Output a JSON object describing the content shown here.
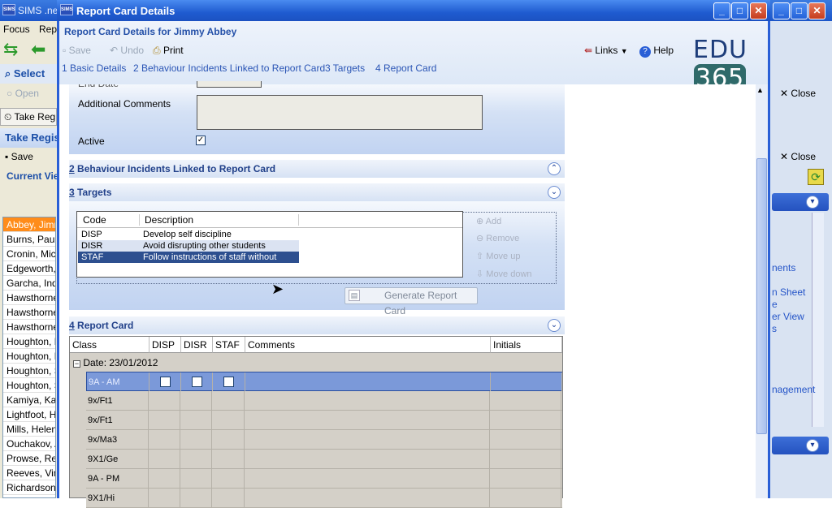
{
  "background_app": {
    "title": "SIMS .net",
    "menu": [
      "Focus",
      "Rep"
    ],
    "select_label": "Select",
    "open_label": "Open",
    "take_register_btn": "Take Reg",
    "take_register_head": "Take Regis",
    "save_label": "Save",
    "current_view_label": "Current Vie",
    "pupils": [
      "Abbey, Jimm",
      "Burns, Paul",
      "Cronin, Mich",
      "Edgeworth, I",
      "Garcha, Inde",
      "Hawsthorne",
      "Hawsthorne",
      "Hawsthorne",
      "Houghton, H",
      "Houghton, R",
      "Houghton, S",
      "Houghton, S",
      "Kamiya, Kad",
      "Lightfoot, Ha",
      "Mills, Helen",
      "Ouchakov, A",
      "Prowse, Reg",
      "Reeves, Vin",
      "Richardson,"
    ],
    "right_close_1": "Close",
    "right_close_2": "Close",
    "right_links": [
      "nents",
      "n Sheet",
      "e",
      "er View",
      "s",
      "nagement"
    ]
  },
  "dialog": {
    "title": "Report Card Details",
    "header_title": "Report Card Details for Jimmy Abbey",
    "toolbar": {
      "save": "Save",
      "undo": "Undo",
      "print": "Print",
      "links": "Links",
      "help": "Help"
    },
    "steps": [
      "1 Basic Details",
      "2 Behaviour Incidents Linked to Report Card",
      "3 Targets",
      "4 Report Card"
    ],
    "logo_prefix": "EDU",
    "logo_number": "365",
    "basic": {
      "end_date_label": "End Date",
      "additional_comments_label": "Additional Comments",
      "active_label": "Active",
      "active_checked": true
    },
    "sections": {
      "behaviour": {
        "num": "2",
        "title": "Behaviour Incidents Linked to Report Card"
      },
      "targets": {
        "num": "3",
        "title": "Targets"
      },
      "report_card": {
        "num": "4",
        "title": "Report Card"
      }
    },
    "targets": {
      "columns": [
        "Code",
        "Description"
      ],
      "rows": [
        {
          "code": "DISP",
          "desc": "Develop self discipline"
        },
        {
          "code": "DISR",
          "desc": "Avoid disrupting other students"
        },
        {
          "code": "STAF",
          "desc": "Follow instructions of staff without que..."
        }
      ],
      "side_buttons": [
        "Add",
        "Remove",
        "Move up",
        "Move down"
      ],
      "generate_button": "Generate Report Card"
    },
    "report_card": {
      "columns": [
        "Class",
        "DISP",
        "DISR",
        "STAF",
        "Comments",
        "Initials"
      ],
      "date_group": "Date: 23/01/2012",
      "rows": [
        "9A - AM",
        "9x/Ft1",
        "9x/Ft1",
        "9x/Ma3",
        "9X1/Ge",
        "9A - PM",
        "9X1/Hi"
      ]
    }
  },
  "colors": {
    "title_bar": "#1f5bd0",
    "accent_text": "#22418a",
    "selected_pupil": "#ff8c1a",
    "selected_row": "#7b99d9"
  }
}
